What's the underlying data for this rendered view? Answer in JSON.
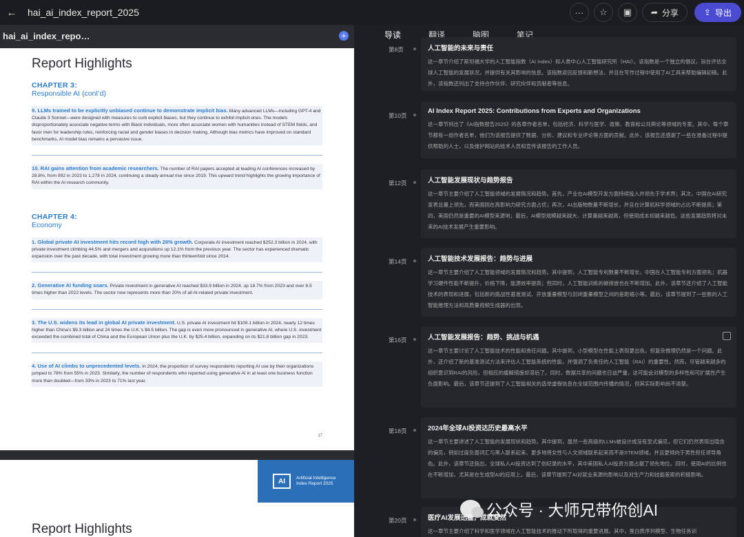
{
  "window": {
    "title": "hai_ai_index_report_2025",
    "back_icon": "arrow-left-icon",
    "share_label": "分享",
    "export_label": "导出"
  },
  "sidebar": {
    "doc_name": "hai_ai_index_repo…"
  },
  "tabs": [
    "导读",
    "翻译",
    "脑图",
    "笔记"
  ],
  "pdf": {
    "page1": {
      "heading": "Report Highlights",
      "chapter3_title": "CHAPTER 3:",
      "chapter3_sub": "Responsible AI (cont’d)",
      "item9_title": "9. LLMs trained to be explicitly unbiased continue to demonstrate implicit bias.",
      "item9_body": " Many advanced LLMs—including GPT-4 and Claude 3 Sonnet—were designed with measures to curb explicit biases, but they continue to exhibit implicit ones. The models disproportionately associate negative terms with Black individuals, more often associate women with humanities instead of STEM fields, and favor men for leadership roles, reinforcing racial and gender biases in decision making. Although bias metrics have improved on standard benchmarks, AI model bias remains a pervasive issue.",
      "item10_title": "10. RAI gains attention from academic researchers.",
      "item10_body": " The number of RAI papers accepted at leading AI conferences increased by 28.8%, from 992 in 2023 to 1,278 in 2024, continuing a steady annual rise since 2019. This upward trend highlights the growing importance of RAI within the AI research community.",
      "chapter4_title": "CHAPTER 4:",
      "chapter4_sub": "Economy",
      "e1_title": "1. Global private AI investment hits record high with 26% growth.",
      "e1_body": " Corporate AI investment reached $252.3 billion in 2024, with private investment climbing 44.5% and mergers and acquisitions up 12.1% from the previous year. The sector has experienced dramatic expansion over the past decade, with total investment growing more than thirteenfold since 2014.",
      "e2_title": "2. Generative AI funding soars.",
      "e2_body": " Private investment in generative AI reached $33.9 billion in 2024, up 18.7% from 2023 and over 8.5 times higher than 2022 levels. The sector now represents more than 20% of all AI-related private investment.",
      "e3_title": "3. The U.S. widens its lead in global AI private investment.",
      "e3_body": " U.S. private AI investment hit $109.1 billion in 2024, nearly 12 times higher than China’s $9.3 billion and 24 times the U.K.’s $4.5 billion. The gap is even more pronounced in generative AI, where U.S. investment exceeded the combined total of China and the European Union plus the U.K. by $25.4 billion, expanding on its $21.8 billion gap in 2023.",
      "e4_title": "4. Use of AI climbs to unprecedented levels.",
      "e4_body": " In 2024, the proportion of survey respondents reporting AI use by their organizations jumped to 78% from 55% in 2023. Similarly, the number of respondents who reported using generative AI in at least one business function more than doubled—from 33% in 2023 to 71% last year.",
      "page_number": "17"
    },
    "page2": {
      "logo_text": "AI",
      "badge_line1": "Artificial Intelligence",
      "badge_line2": "Index Report 2025",
      "heading": "Report Highlights"
    }
  },
  "entries": [
    {
      "page": "第8页",
      "title": "人工智能的未来与责任",
      "body": "这一章节介绍了斯坦福大学的人工智能指数（AI Index）和人类中心人工智能研究所（HAI）。该指数是一个独立的倡议，旨在评估全球人工智能的发展状况，并提供有关其影响的信息。该指数返回反馈和新想法，并且在写作过程中使用了AI工具来帮助编辑初稿。此外，该指数还列出了支持合作伙伴、研究伙伴和贡献者等信息。"
    },
    {
      "page": "第10页",
      "title": "AI Index Report 2025: Contributions from Experts and Organizations",
      "body": "这一章节列出了《AI指数报告2025》的各章作者名单，包括经济、科学与医学、政策、教育和公共舆论等领域的专家。其中，每个章节都有一组作者名单，他们为该报告提供了数据、分析、建议和专业评论等方面的贡献。此外，该报告还感谢了一些在准备过程中提供帮助的人士，以及维护网站的技术人员和宣传该报告的工作人员。"
    },
    {
      "page": "第12页",
      "title": "人工智能发展现状与趋势报告",
      "body": "这一章节主要介绍了人工智能领域的发展情况和趋势。首先，产业在AI模型开发方面持续投入并领先于学术界；其次，中国在AI研究发表总量上领先，而美国则在高影响力研究方面占优；再次，AI出版物数量不断增长，并且在计算机科学领域的占比不断提高；第四，美国仍然是重要的AI模型来源地；最后，AI模型规模越来越大、计算量越来越高，但使用成本却越来越低。这些发展趋势将对未来的AI技术发展产生重要影响。"
    },
    {
      "page": "第14页",
      "title": "人工智能技术发展报告：趋势与进展",
      "body": "这一章节主要介绍了人工智能领域的发展情况和趋势。其中提到，人工智能专利数量不断增长，中国在人工智能专利方面领先；机器学习硬件性能不断提升，价格下降，能源效率提高；但同时，人工智能训练的碳排放也在不断增加。此外，该章节还介绍了人工智能技术的表现和进展，包括新的挑战性基准测试、开放重量模型与封闭重量模型之间的差距缩小等。最后，该章节提到了一些新的人工智能推理方法和高质量视频生成器的出现。"
    },
    {
      "page": "第16页",
      "title": "人工智能发展报告：趋势、挑战与机遇",
      "body": "这一章节主要讨论了人工智能技术的性能和责任问题。其中提到，小型模型在性能上表现更出色，但复杂推理仍然是一个问题。此外，还介绍了新的基准测试方法来评估人工智能系统的性能，并强调了负责任的人工智能（RAI）的重要性。然而，尽管越来越多的组织意识到RAI的风险，但相应的缓解措施却滞后了。同时，数据共享的问题也日益严重，这可能会对模型的多样性和可扩展性产生负面影响。最后，该章节还提到了人工智能相关的选举虚假信息在全球范围内传播的情况，但其实际影响尚不清楚。"
    },
    {
      "page": "第18页",
      "title": "2024年全球AI投资达历史最高水平",
      "body": "这一章节主要讲述了人工智能的发展现状和趋势。其中提到，虽然一些高级的LLMs被设计成没有显式偏见，但它们仍然表现出隐含的偏见，例如过度负面词汇与黑人联系起来、更多地将女性与人文领域联系起来而不是STEM领域，并且更倾向于男性担任领导角色。此外，该章节还指出，全球私人AI投资达到了创纪录的水平，其中美国私人AI投资方面占据了领先地位。同时，使用AI的比例也在不断增加，尤其是在生成型AI的应用上。最后，该章节提到了AI对就业来源的影响以及对生产力和技能差距的积极影响。"
    },
    {
      "page": "第20页",
      "title": "医疗AI发展迅猛，成就斐然",
      "body": "这一章节主要介绍了科学和医学领域在人工智能技术的推动下所取得的重要进展。其中，蛋白质序列模型、生物任务训"
    }
  ],
  "watermark": "公众号 · 大师兄带你创AI"
}
